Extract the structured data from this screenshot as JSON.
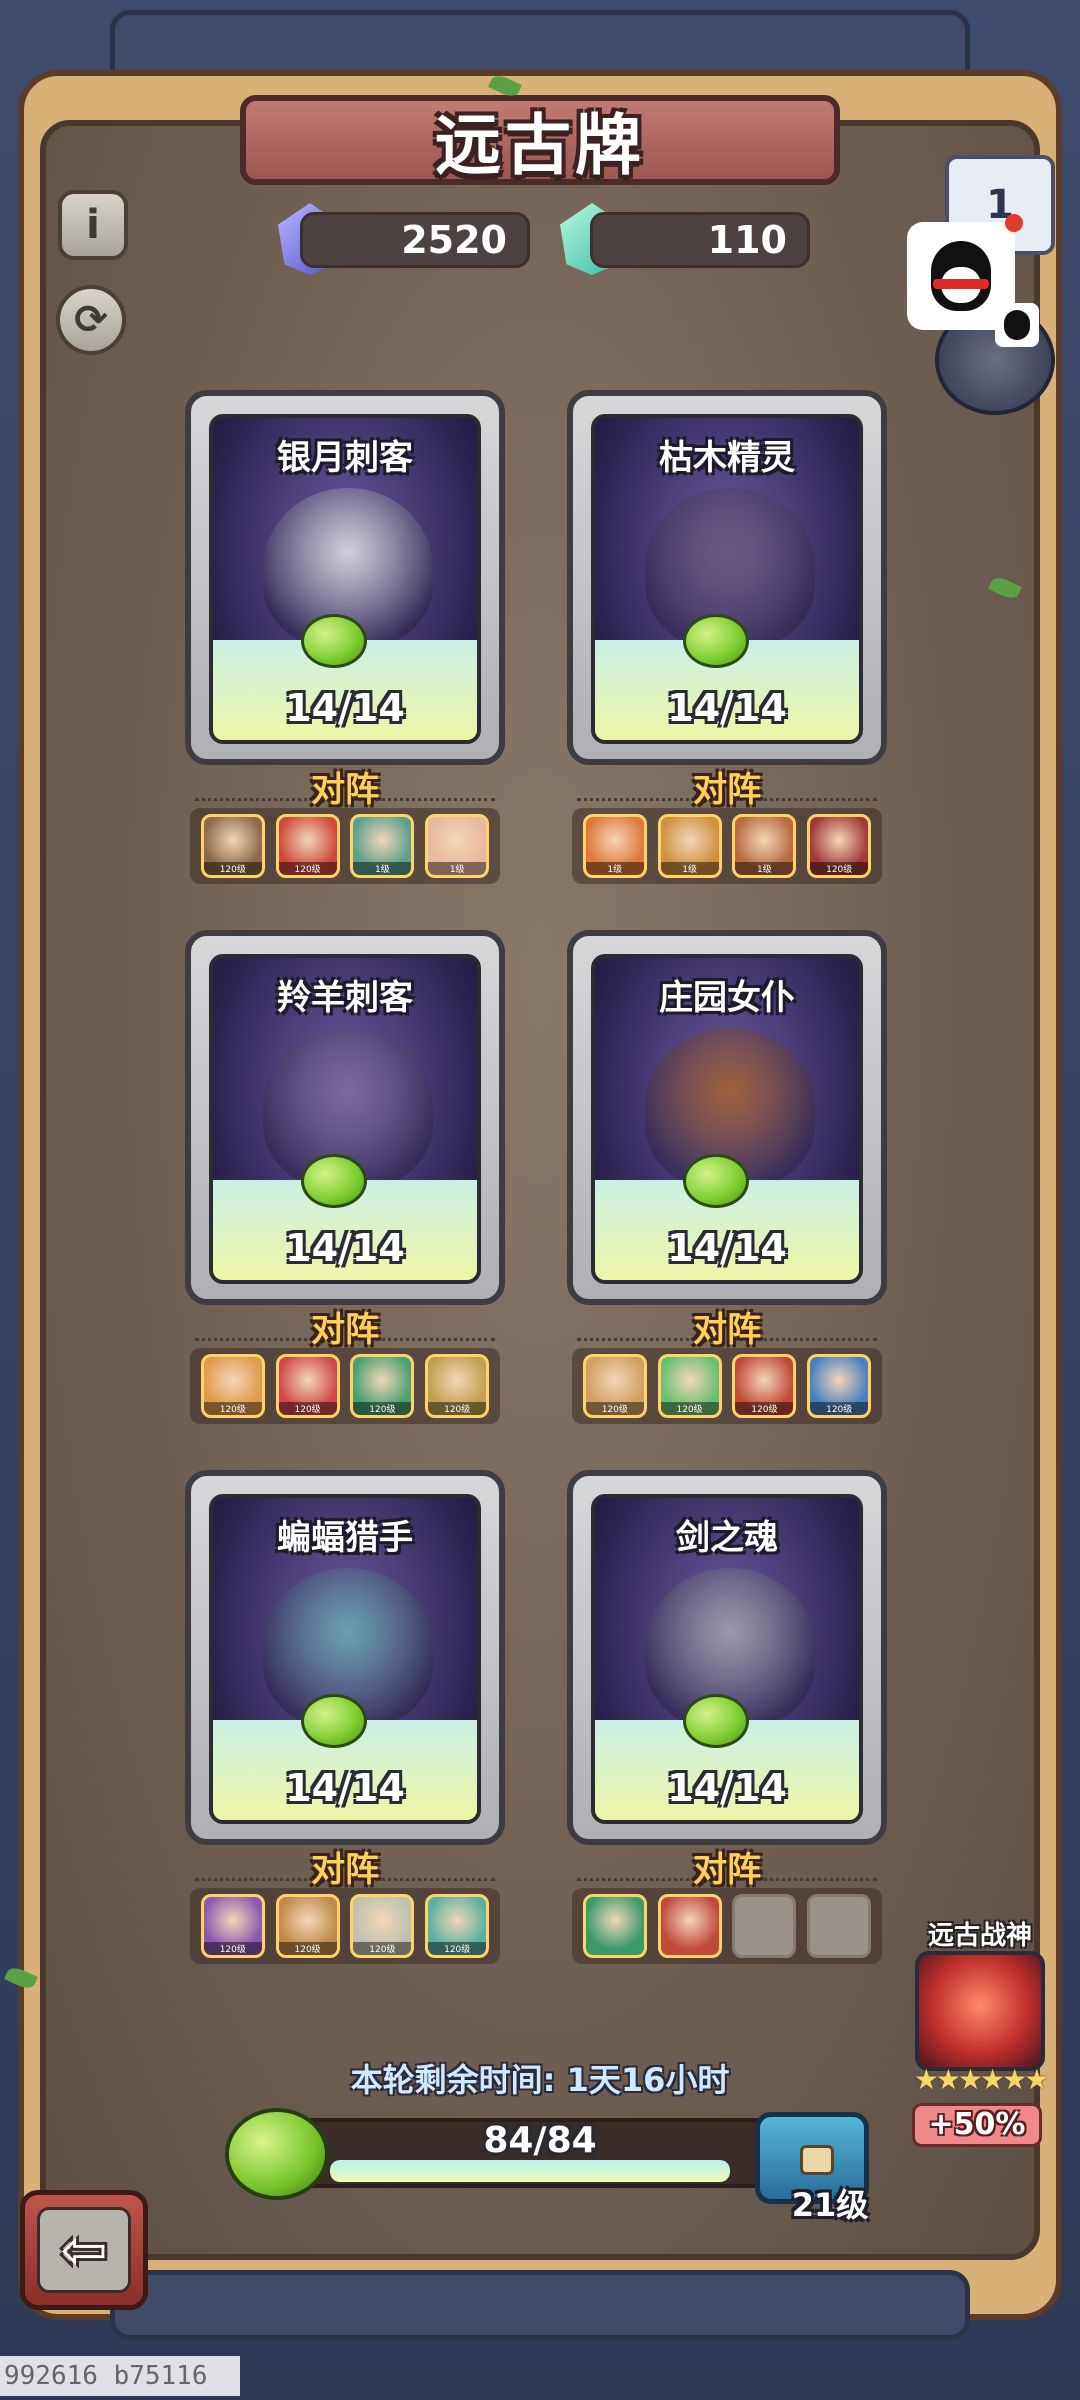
{
  "title": "远古牌",
  "currencies": [
    {
      "icon": "blue-gem-icon",
      "value": "2520"
    },
    {
      "icon": "green-gem-icon",
      "value": "110"
    }
  ],
  "buttons": {
    "info": "i",
    "refresh": "⟳",
    "calendar": "1",
    "back": "⇦"
  },
  "lineup_label": "对阵",
  "cards": [
    {
      "name": "银月刺客",
      "count": "14/14",
      "figure_color": "#cfcfd8",
      "lineup": [
        {
          "lvl": "120级",
          "color": "#8a6a4a"
        },
        {
          "lvl": "120级",
          "color": "#d04a3a"
        },
        {
          "lvl": "1级",
          "color": "#5aa08a"
        },
        {
          "lvl": "1级",
          "color": "#e8b8a0"
        }
      ]
    },
    {
      "name": "枯木精灵",
      "count": "14/14",
      "figure_color": "#6a5a80",
      "lineup": [
        {
          "lvl": "1级",
          "color": "#e0783a"
        },
        {
          "lvl": "1级",
          "color": "#d09040"
        },
        {
          "lvl": "1级",
          "color": "#b86a40"
        },
        {
          "lvl": "120级",
          "color": "#a03a3a"
        }
      ]
    },
    {
      "name": "羚羊刺客",
      "count": "14/14",
      "figure_color": "#7a6a9a",
      "lineup": [
        {
          "lvl": "120级",
          "color": "#e09a4a"
        },
        {
          "lvl": "120级",
          "color": "#d04a4a"
        },
        {
          "lvl": "120级",
          "color": "#4aa070"
        },
        {
          "lvl": "120级",
          "color": "#c0a050"
        }
      ]
    },
    {
      "name": "庄园女仆",
      "count": "14/14",
      "figure_color": "#a0603a",
      "lineup": [
        {
          "lvl": "120级",
          "color": "#d0a060"
        },
        {
          "lvl": "120级",
          "color": "#6ac070"
        },
        {
          "lvl": "120级",
          "color": "#c04a3a"
        },
        {
          "lvl": "120级",
          "color": "#4a80c0"
        }
      ]
    },
    {
      "name": "蝙蝠猎手",
      "count": "14/14",
      "figure_color": "#6aa0b0",
      "lineup": [
        {
          "lvl": "120级",
          "color": "#8a5ab0"
        },
        {
          "lvl": "120级",
          "color": "#c08a4a"
        },
        {
          "lvl": "120级",
          "color": "#c0c0b0"
        },
        {
          "lvl": "120级",
          "color": "#5ab0a0"
        }
      ]
    },
    {
      "name": "剑之魂",
      "count": "14/14",
      "figure_color": "#9a9aa8",
      "lineup": [
        {
          "lvl": "",
          "color": "#3a9a6a"
        },
        {
          "lvl": "",
          "color": "#c04a3a"
        },
        {
          "lvl": "",
          "color": "empty"
        },
        {
          "lvl": "",
          "color": "empty"
        }
      ]
    }
  ],
  "timer": "本轮剩余时间: 1天16小时",
  "progress": {
    "current": 84,
    "max": 84,
    "label": "84/84"
  },
  "chest": {
    "level": "21级"
  },
  "ancient_god": {
    "title": "远古战神",
    "stars": "★★★★★★",
    "bonus": "+50%"
  },
  "watermark": "992616 b75116",
  "colors": {
    "accent_gold": "#ffcf5a",
    "frame_brown": "#5b3b2a",
    "banner_red": "#9b5750"
  }
}
